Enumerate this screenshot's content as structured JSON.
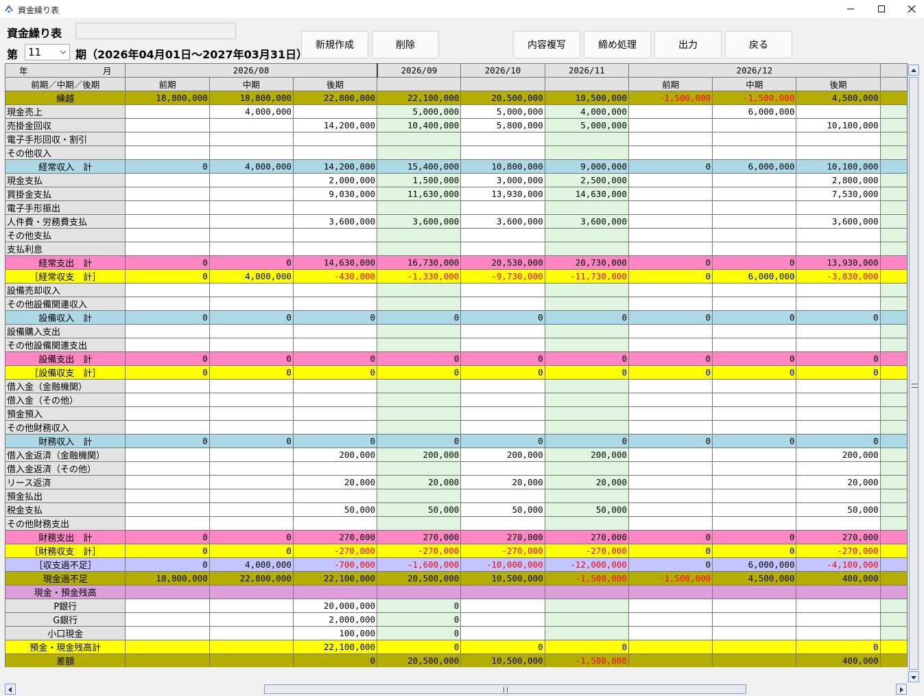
{
  "window": {
    "title": "資金繰り表"
  },
  "form": {
    "title": "資金繰り表",
    "period_prefix": "第",
    "period_number": "11",
    "period_label": "期（2026年04月01日～2027年03月31日）"
  },
  "toolbar": {
    "new_label": "新規作成",
    "delete_label": "削除",
    "copy_label": "内容複写",
    "close_label": "締め処理",
    "output_label": "出力",
    "back_label": "戻る"
  },
  "colors": {
    "carry": "#b5ae00",
    "income_total": "#add8e6",
    "expense_total": "#ff86c4",
    "balance": "#ffff00",
    "overall": "#c4c4ff",
    "cash_header": "#dda0dd",
    "month_tint": "#dff5df",
    "negative": "#ff0000"
  },
  "grid": {
    "header_row1_label_year": "年",
    "header_row1_label_month": "月",
    "header_row2_label": "前期／中期／後期",
    "months": [
      {
        "label": "2026/08",
        "span": 3
      },
      {
        "label": "2026/09",
        "span": 1
      },
      {
        "label": "2026/10",
        "span": 1
      },
      {
        "label": "2026/11",
        "span": 1
      },
      {
        "label": "2026/12",
        "span": 3
      }
    ],
    "subheaders": [
      "前期",
      "中期",
      "後期",
      "",
      "",
      "",
      "前期",
      "中期",
      "後期"
    ],
    "rows": [
      {
        "label": "繰越",
        "style": "carry",
        "values": [
          "18,800,000",
          "18,800,000",
          "22,800,000",
          "22,100,000",
          "20,500,000",
          "10,500,000",
          "-1,500,000",
          "-1,500,000",
          "4,500,000"
        ]
      },
      {
        "label": "現金売上",
        "style": "",
        "values": [
          "",
          "4,000,000",
          "",
          "5,000,000",
          "5,000,000",
          "4,000,000",
          "",
          "6,000,000",
          ""
        ]
      },
      {
        "label": "売掛金回収",
        "style": "",
        "values": [
          "",
          "",
          "14,200,000",
          "10,400,000",
          "5,800,000",
          "5,000,000",
          "",
          "",
          "10,100,000"
        ]
      },
      {
        "label": "電子手形回収・割引",
        "style": "",
        "values": [
          "",
          "",
          "",
          "",
          "",
          "",
          "",
          "",
          ""
        ]
      },
      {
        "label": "その他収入",
        "style": "",
        "values": [
          "",
          "",
          "",
          "",
          "",
          "",
          "",
          "",
          ""
        ]
      },
      {
        "label": "経常収入　計",
        "style": "income",
        "values": [
          "0",
          "4,000,000",
          "14,200,000",
          "15,400,000",
          "10,800,000",
          "9,000,000",
          "0",
          "6,000,000",
          "10,100,000"
        ]
      },
      {
        "label": "現金支払",
        "style": "",
        "values": [
          "",
          "",
          "2,000,000",
          "1,500,000",
          "3,000,000",
          "2,500,000",
          "",
          "",
          "2,800,000"
        ]
      },
      {
        "label": "買掛金支払",
        "style": "",
        "values": [
          "",
          "",
          "9,030,000",
          "11,630,000",
          "13,930,000",
          "14,630,000",
          "",
          "",
          "7,530,000"
        ]
      },
      {
        "label": "電子手形振出",
        "style": "",
        "values": [
          "",
          "",
          "",
          "",
          "",
          "",
          "",
          "",
          ""
        ]
      },
      {
        "label": "人件費・労務費支払",
        "style": "",
        "values": [
          "",
          "",
          "3,600,000",
          "3,600,000",
          "3,600,000",
          "3,600,000",
          "",
          "",
          "3,600,000"
        ]
      },
      {
        "label": "その他支払",
        "style": "",
        "values": [
          "",
          "",
          "",
          "",
          "",
          "",
          "",
          "",
          ""
        ]
      },
      {
        "label": "支払利息",
        "style": "",
        "values": [
          "",
          "",
          "",
          "",
          "",
          "",
          "",
          "",
          ""
        ]
      },
      {
        "label": "経常支出　計",
        "style": "expense",
        "values": [
          "0",
          "0",
          "14,630,000",
          "16,730,000",
          "20,530,000",
          "20,730,000",
          "0",
          "0",
          "13,930,000"
        ]
      },
      {
        "label": "［経常収支　計］",
        "style": "balance",
        "values": [
          "0",
          "4,000,000",
          "-430,000",
          "-1,330,000",
          "-9,730,000",
          "-11,730,000",
          "0",
          "6,000,000",
          "-3,830,000"
        ]
      },
      {
        "label": "設備売却収入",
        "style": "",
        "values": [
          "",
          "",
          "",
          "",
          "",
          "",
          "",
          "",
          ""
        ]
      },
      {
        "label": "その他設備関連収入",
        "style": "",
        "values": [
          "",
          "",
          "",
          "",
          "",
          "",
          "",
          "",
          ""
        ]
      },
      {
        "label": "設備収入　計",
        "style": "income",
        "values": [
          "0",
          "0",
          "0",
          "0",
          "0",
          "0",
          "0",
          "0",
          "0"
        ]
      },
      {
        "label": "設備購入支出",
        "style": "",
        "values": [
          "",
          "",
          "",
          "",
          "",
          "",
          "",
          "",
          ""
        ]
      },
      {
        "label": "その他設備関連支出",
        "style": "",
        "values": [
          "",
          "",
          "",
          "",
          "",
          "",
          "",
          "",
          ""
        ]
      },
      {
        "label": "設備支出　計",
        "style": "expense",
        "values": [
          "0",
          "0",
          "0",
          "0",
          "0",
          "0",
          "0",
          "0",
          "0"
        ]
      },
      {
        "label": "［設備収支　計］",
        "style": "balance",
        "values": [
          "0",
          "0",
          "0",
          "0",
          "0",
          "0",
          "0",
          "0",
          "0"
        ]
      },
      {
        "label": "借入金（金融機関）",
        "style": "",
        "values": [
          "",
          "",
          "",
          "",
          "",
          "",
          "",
          "",
          ""
        ]
      },
      {
        "label": "借入金（その他）",
        "style": "",
        "values": [
          "",
          "",
          "",
          "",
          "",
          "",
          "",
          "",
          ""
        ]
      },
      {
        "label": "預金預入",
        "style": "",
        "values": [
          "",
          "",
          "",
          "",
          "",
          "",
          "",
          "",
          ""
        ]
      },
      {
        "label": "その他財務収入",
        "style": "",
        "values": [
          "",
          "",
          "",
          "",
          "",
          "",
          "",
          "",
          ""
        ]
      },
      {
        "label": "財務収入　計",
        "style": "income",
        "values": [
          "0",
          "0",
          "0",
          "0",
          "0",
          "0",
          "0",
          "0",
          "0"
        ]
      },
      {
        "label": "借入金返済（金融機関）",
        "style": "",
        "values": [
          "",
          "",
          "200,000",
          "200,000",
          "200,000",
          "200,000",
          "",
          "",
          "200,000"
        ]
      },
      {
        "label": "借入金返済（その他）",
        "style": "",
        "values": [
          "",
          "",
          "",
          "",
          "",
          "",
          "",
          "",
          ""
        ]
      },
      {
        "label": "リース返済",
        "style": "",
        "values": [
          "",
          "",
          "20,000",
          "20,000",
          "20,000",
          "20,000",
          "",
          "",
          "20,000"
        ]
      },
      {
        "label": "預金払出",
        "style": "",
        "values": [
          "",
          "",
          "",
          "",
          "",
          "",
          "",
          "",
          ""
        ]
      },
      {
        "label": "税金支払",
        "style": "",
        "values": [
          "",
          "",
          "50,000",
          "50,000",
          "50,000",
          "50,000",
          "",
          "",
          "50,000"
        ]
      },
      {
        "label": "その他財務支出",
        "style": "",
        "values": [
          "",
          "",
          "",
          "",
          "",
          "",
          "",
          "",
          ""
        ]
      },
      {
        "label": "財務支出　計",
        "style": "expense",
        "values": [
          "0",
          "0",
          "270,000",
          "270,000",
          "270,000",
          "270,000",
          "0",
          "0",
          "270,000"
        ]
      },
      {
        "label": "［財務収支　計］",
        "style": "balance",
        "values": [
          "0",
          "0",
          "-270,000",
          "-270,000",
          "-270,000",
          "-270,000",
          "0",
          "0",
          "-270,000"
        ]
      },
      {
        "label": "［収支過不足］",
        "style": "overall",
        "values": [
          "0",
          "4,000,000",
          "-700,000",
          "-1,600,000",
          "-10,000,000",
          "-12,000,000",
          "0",
          "6,000,000",
          "-4,100,000"
        ]
      },
      {
        "label": "現金過不足",
        "style": "carry",
        "values": [
          "18,800,000",
          "22,800,000",
          "22,100,000",
          "20,500,000",
          "10,500,000",
          "-1,500,000",
          "-1,500,000",
          "4,500,000",
          "400,000"
        ]
      },
      {
        "label": "現金・預金残高",
        "style": "cashhead",
        "values": [
          "",
          "",
          "",
          "",
          "",
          "",
          "",
          "",
          ""
        ]
      },
      {
        "label": "P銀行",
        "style": "indent",
        "values": [
          "",
          "",
          "20,000,000",
          "0",
          "",
          "",
          "",
          "",
          ""
        ]
      },
      {
        "label": "G銀行",
        "style": "indent",
        "values": [
          "",
          "",
          "2,000,000",
          "0",
          "",
          "",
          "",
          "",
          ""
        ]
      },
      {
        "label": "小口現金",
        "style": "indent",
        "values": [
          "",
          "",
          "100,000",
          "0",
          "",
          "",
          "",
          "",
          ""
        ]
      },
      {
        "label": "預金・現金残高計",
        "style": "balance",
        "values": [
          "",
          "",
          "22,100,000",
          "0",
          "0",
          "0",
          "",
          "",
          "0"
        ]
      },
      {
        "label": "差額",
        "style": "carry",
        "values": [
          "",
          "",
          "0",
          "20,500,000",
          "10,500,000",
          "-1,500,000",
          "",
          "",
          "400,000"
        ]
      }
    ]
  }
}
